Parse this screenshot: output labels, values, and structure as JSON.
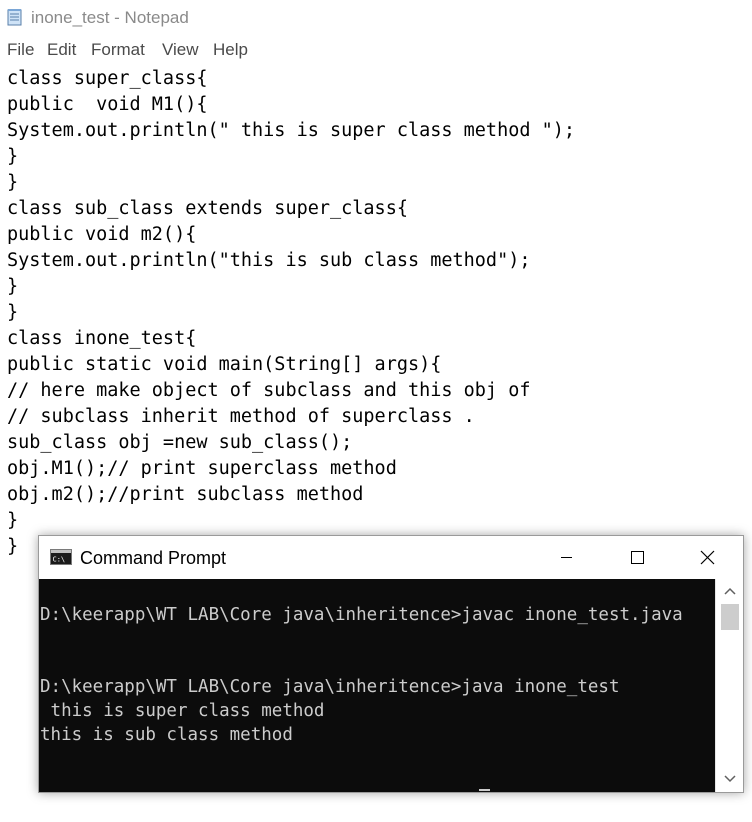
{
  "notepad": {
    "title": "inone_test - Notepad",
    "icon": "notepad-icon",
    "menu": [
      "File",
      "Edit",
      "Format",
      "View",
      "Help"
    ],
    "code": "class super_class{\npublic  void M1(){\nSystem.out.println(\" this is super class method \");\n}\n}\nclass sub_class extends super_class{\npublic void m2(){\nSystem.out.println(\"this is sub class method\");\n}\n}\nclass inone_test{\npublic static void main(String[] args){\n// here make object of subclass and this obj of\n// subclass inherit method of superclass .\nsub_class obj =new sub_class();\nobj.M1();// print superclass method\nobj.m2();//print subclass method\n}\n}"
  },
  "cmd": {
    "title": "Command Prompt",
    "icon": "command-prompt-icon",
    "controls": [
      "minimize-icon",
      "maximize-icon",
      "close-icon"
    ],
    "output": "D:\\keerapp\\WT LAB\\Core java\\inheritence>javac inone_test.java\n\n\nD:\\keerapp\\WT LAB\\Core java\\inheritence>java inone_test\n this is super class method\nthis is sub class method"
  },
  "colors": {
    "console_bg": "#0c0c0c",
    "console_fg": "#cccccc",
    "menu_text": "#4a4a4a"
  }
}
